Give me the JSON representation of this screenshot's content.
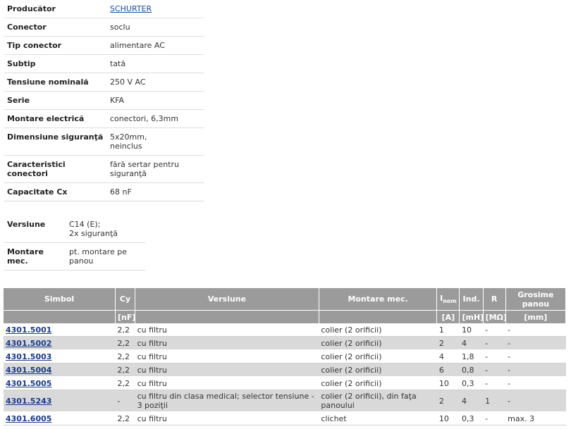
{
  "specs": [
    {
      "label": "Producător",
      "value": "SCHURTER",
      "link": true
    },
    {
      "label": "Conector",
      "value": "soclu"
    },
    {
      "label": "Tip conector",
      "value": "alimentare AC"
    },
    {
      "label": "Subtip",
      "value": "tată"
    },
    {
      "label": "Tensiune nominală",
      "value": "250 V AC"
    },
    {
      "label": "Serie",
      "value": "KFA"
    },
    {
      "label": "Montare electrică",
      "value": "conectori, 6,3mm"
    },
    {
      "label": "Dimensiune siguranţă",
      "value": "5x20mm,\nneinclus"
    },
    {
      "label": "Caracteristici conectori",
      "value": "fără sertar pentru siguranţă"
    },
    {
      "label": "Capacitate Cx",
      "value": "68 nF"
    }
  ],
  "variant": [
    {
      "label": "Versiune",
      "value": "C14 (E);\n2x siguranţă"
    },
    {
      "label": "Montare mec.",
      "value": "pt. montare pe panou"
    }
  ],
  "products": {
    "headers": {
      "simbol": "Simbol",
      "cy": "Cy",
      "versiune": "Versiune",
      "montare": "Montare mec.",
      "inom_main": "I",
      "inom_sub": "nom",
      "ind": "Ind.",
      "r": "R",
      "grosime": "Grosime panou"
    },
    "units": {
      "cy": "[nF]",
      "inom": "[A]",
      "ind": "[mH]",
      "r": "[MΩ]",
      "grosime": "[mm]"
    },
    "rows": [
      {
        "simbol": "4301.5001",
        "cy": "2,2",
        "versiune": "cu filtru",
        "montare": "colier (2 orificii)",
        "inom": "1",
        "ind": "10",
        "r": "-",
        "grosime": "-"
      },
      {
        "simbol": "4301.5002",
        "cy": "2,2",
        "versiune": "cu filtru",
        "montare": "colier (2 orificii)",
        "inom": "2",
        "ind": "4",
        "r": "-",
        "grosime": "-"
      },
      {
        "simbol": "4301.5003",
        "cy": "2,2",
        "versiune": "cu filtru",
        "montare": "colier (2 orificii)",
        "inom": "4",
        "ind": "1,8",
        "r": "-",
        "grosime": "-"
      },
      {
        "simbol": "4301.5004",
        "cy": "2,2",
        "versiune": "cu filtru",
        "montare": "colier (2 orificii)",
        "inom": "6",
        "ind": "0,8",
        "r": "-",
        "grosime": "-"
      },
      {
        "simbol": "4301.5005",
        "cy": "2,2",
        "versiune": "cu filtru",
        "montare": "colier (2 orificii)",
        "inom": "10",
        "ind": "0,3",
        "r": "-",
        "grosime": "-"
      },
      {
        "simbol": "4301.5243",
        "cy": "-",
        "versiune": "cu filtru din clasa medical; selector tensiune - 3 poziţii",
        "montare": "colier (2 orificii), din faţa panoului",
        "inom": "2",
        "ind": "4",
        "r": "1",
        "grosime": "-"
      },
      {
        "simbol": "4301.6005",
        "cy": "2,2",
        "versiune": "cu filtru",
        "montare": "clichet",
        "inom": "10",
        "ind": "0,3",
        "r": "-",
        "grosime": "max. 3"
      }
    ]
  }
}
